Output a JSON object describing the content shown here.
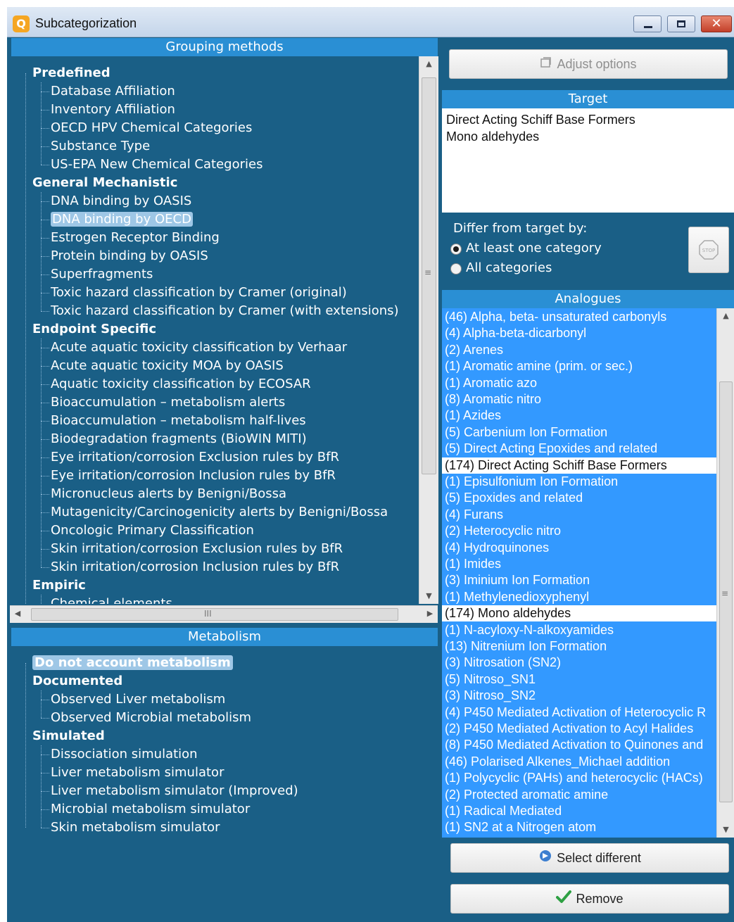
{
  "window": {
    "title": "Subcategorization",
    "app_icon_glyph": "Q",
    "controls": {
      "minimize": "minimize-icon",
      "maximize": "maximize-icon",
      "close": "✕"
    }
  },
  "grouping": {
    "header": "Grouping methods",
    "groups": [
      {
        "label": "Predefined",
        "items": [
          "Database Affiliation",
          "Inventory Affiliation",
          "OECD HPV Chemical Categories",
          "Substance Type",
          "US-EPA New Chemical Categories"
        ]
      },
      {
        "label": "General Mechanistic",
        "items": [
          "DNA binding by OASIS",
          "DNA binding by OECD",
          "Estrogen Receptor Binding",
          "Protein binding by OASIS",
          "Superfragments",
          "Toxic hazard classification by Cramer (original)",
          "Toxic hazard classification by Cramer (with extensions)"
        ]
      },
      {
        "label": "Endpoint Specific",
        "items": [
          "Acute aquatic toxicity classification by Verhaar",
          "Acute aquatic toxicity MOA by OASIS",
          "Aquatic toxicity classification by ECOSAR",
          "Bioaccumulation – metabolism alerts",
          "Bioaccumulation – metabolism half-lives",
          "Biodegradation fragments (BioWIN MITI)",
          "Eye irritation/corrosion Exclusion rules by BfR",
          "Eye irritation/corrosion Inclusion rules by BfR",
          "Micronucleus alerts by Benigni/Bossa",
          "Mutagenicity/Carcinogenicity alerts by Benigni/Bossa",
          "Oncologic Primary Classification",
          "Skin irritation/corrosion Exclusion rules by BfR",
          "Skin irritation/corrosion Inclusion rules by BfR"
        ]
      },
      {
        "label": "Empiric",
        "items": [
          "Chemical elements"
        ]
      }
    ],
    "selected": "DNA binding by OECD",
    "hscroll_grip": "III",
    "vscroll_grip": "≡"
  },
  "metabolism": {
    "header": "Metabolism",
    "top_item": "Do not account metabolism",
    "groups": [
      {
        "label": "Documented",
        "items": [
          "Observed Liver metabolism",
          "Observed Microbial metabolism"
        ]
      },
      {
        "label": "Simulated",
        "items": [
          "Dissociation simulation",
          "Liver metabolism simulator",
          "Liver metabolism simulator (Improved)",
          "Microbial metabolism simulator",
          "Skin metabolism simulator"
        ]
      }
    ]
  },
  "adjust_options": {
    "label": "Adjust options",
    "icon": "options-icon"
  },
  "target": {
    "header": "Target",
    "lines": [
      "Direct Acting Schiff Base Formers",
      "Mono aldehydes"
    ]
  },
  "differ": {
    "label": "Differ from target by:",
    "options": [
      "At least one category",
      "All categories"
    ],
    "selected": 0,
    "stop_label": "STOP"
  },
  "analogues": {
    "header": "Analogues",
    "items": [
      "(46) Alpha, beta- unsaturated carbonyls",
      "(4) Alpha-beta-dicarbonyl",
      "(2) Arenes",
      "(1) Aromatic amine (prim. or sec.)",
      "(1) Aromatic azo",
      "(8) Aromatic nitro",
      "(1) Azides",
      "(5) Carbenium Ion Formation",
      "(5) Direct Acting Epoxides and related",
      "(174) Direct Acting Schiff Base Formers",
      "(1) Episulfonium Ion Formation",
      "(5) Epoxides and related",
      "(4) Furans",
      "(2) Heterocyclic nitro",
      "(4) Hydroquinones",
      "(1) Imides",
      "(3) Iminium Ion Formation",
      "(1) Methylenedioxyphenyl",
      "(174) Mono aldehydes",
      "(1) N-acyloxy-N-alkoxyamides",
      "(13) Nitrenium Ion Formation",
      "(3) Nitrosation (SN2)",
      "(5) Nitroso_SN1",
      "(3) Nitroso_SN2",
      "(4) P450 Mediated Activation of Heterocyclic R",
      "(2) P450 Mediated Activation to Acyl Halides",
      "(8) P450 Mediated Activation to Quinones and",
      "(46) Polarised Alkenes_Michael addition",
      "(1) Polycyclic (PAHs) and heterocyclic (HACs)",
      "(2) Protected aromatic amine",
      "(1) Radical Mediated",
      "(1) SN2 at a Nitrogen atom"
    ],
    "highlighted": [
      "(174) Direct Acting Schiff Base Formers",
      "(174) Mono aldehydes"
    ]
  },
  "buttons": {
    "select_different": "Select different",
    "remove": "Remove"
  },
  "colors": {
    "panel_bg": "#1a5f86",
    "header_bg": "#2a8fd4",
    "list_bg": "#3399ff",
    "highlight": "#ffffff",
    "check_green": "#2ea043"
  }
}
